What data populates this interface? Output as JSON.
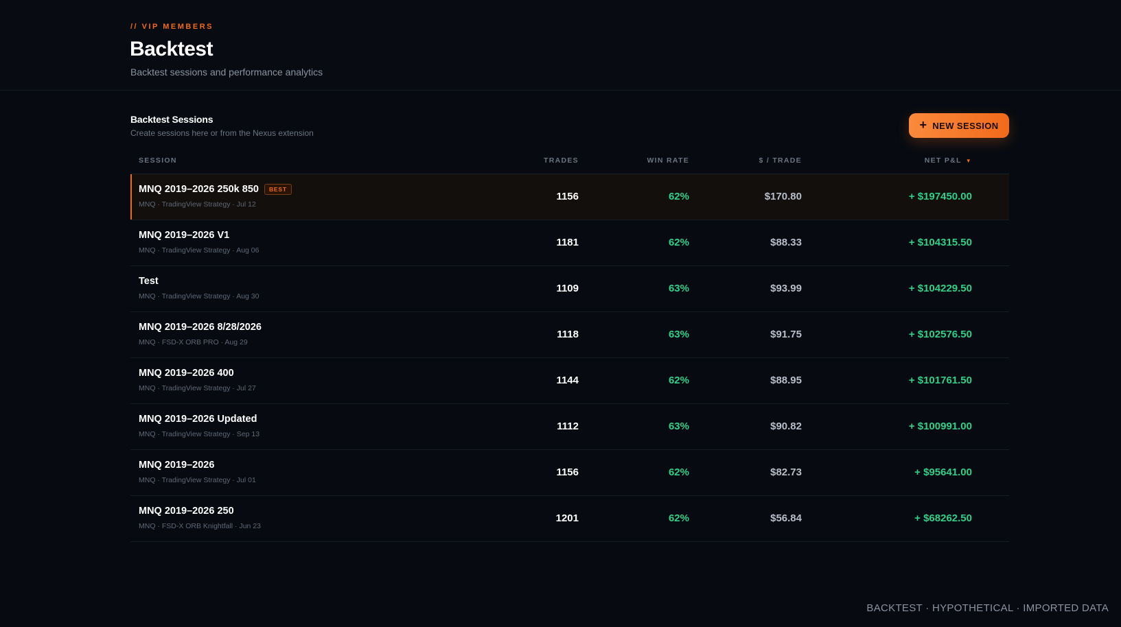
{
  "header": {
    "eyebrow": "// VIP MEMBERS",
    "title": "Backtest",
    "subtitle": "Backtest sessions and performance analytics"
  },
  "section": {
    "title": "Backtest Sessions",
    "subtitle": "Create sessions here or from the Nexus extension",
    "new_button_label": "NEW SESSION",
    "new_button_icon": "plus-icon"
  },
  "table": {
    "columns": {
      "session": "SESSION",
      "trades": "TRADES",
      "win_rate": "WIN RATE",
      "per_trade": "$ / TRADE",
      "net_pnl": "NET P&L",
      "sort_icon": "caret-down-icon"
    },
    "best_badge": "BEST",
    "rows": [
      {
        "name": "MNQ 2019–2026 250k 850",
        "meta": "MNQ · TradingView Strategy · Jul 12",
        "trades": "1156",
        "win_rate": "62%",
        "per_trade": "$170.80",
        "net_pnl": "+ $197450.00",
        "best": true
      },
      {
        "name": "MNQ 2019–2026 V1",
        "meta": "MNQ · TradingView Strategy · Aug 06",
        "trades": "1181",
        "win_rate": "62%",
        "per_trade": "$88.33",
        "net_pnl": "+ $104315.50",
        "best": false
      },
      {
        "name": "Test",
        "meta": "MNQ · TradingView Strategy · Aug 30",
        "trades": "1109",
        "win_rate": "63%",
        "per_trade": "$93.99",
        "net_pnl": "+ $104229.50",
        "best": false
      },
      {
        "name": "MNQ 2019–2026 8/28/2026",
        "meta": "MNQ · FSD-X ORB PRO · Aug 29",
        "trades": "1118",
        "win_rate": "63%",
        "per_trade": "$91.75",
        "net_pnl": "+ $102576.50",
        "best": false
      },
      {
        "name": "MNQ 2019–2026 400",
        "meta": "MNQ · TradingView Strategy · Jul 27",
        "trades": "1144",
        "win_rate": "62%",
        "per_trade": "$88.95",
        "net_pnl": "+ $101761.50",
        "best": false
      },
      {
        "name": "MNQ 2019–2026 Updated",
        "meta": "MNQ · TradingView Strategy · Sep 13",
        "trades": "1112",
        "win_rate": "63%",
        "per_trade": "$90.82",
        "net_pnl": "+ $100991.00",
        "best": false
      },
      {
        "name": "MNQ 2019–2026",
        "meta": "MNQ · TradingView Strategy · Jul 01",
        "trades": "1156",
        "win_rate": "62%",
        "per_trade": "$82.73",
        "net_pnl": "+ $95641.00",
        "best": false
      },
      {
        "name": "MNQ 2019–2026 250",
        "meta": "MNQ · FSD-X ORB Knightfall · Jun 23",
        "trades": "1201",
        "win_rate": "62%",
        "per_trade": "$56.84",
        "net_pnl": "+ $68262.50",
        "best": false
      }
    ]
  },
  "footer": {
    "text": "BACKTEST · HYPOTHETICAL · IMPORTED DATA"
  },
  "colors": {
    "accent": "#f26a1b",
    "positive": "#2fd08a",
    "background": "#070b11"
  }
}
